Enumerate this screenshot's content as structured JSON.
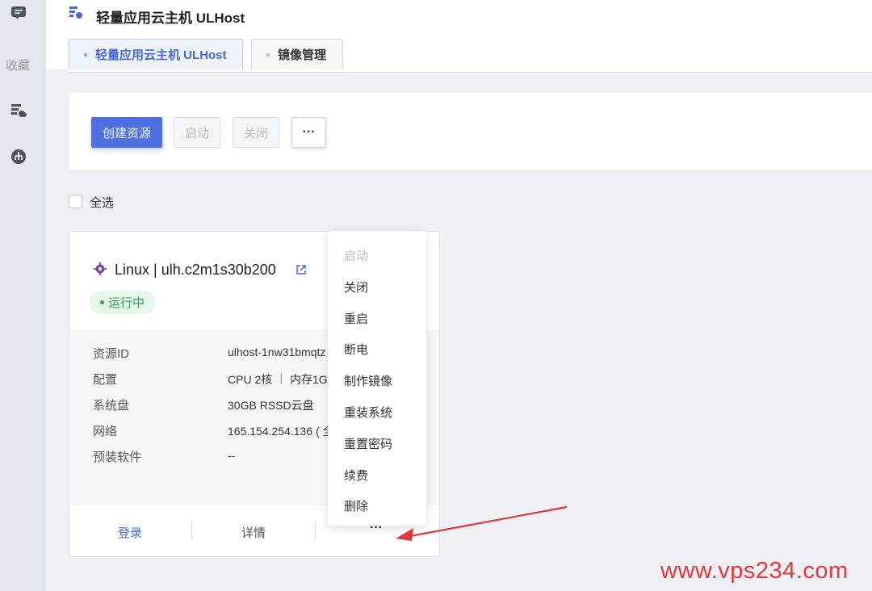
{
  "sidebar": {
    "favorites_label": "收藏"
  },
  "header": {
    "title": "轻量应用云主机 ULHost",
    "tabs": [
      {
        "label": "轻量应用云主机 ULHost"
      },
      {
        "label": "镜像管理"
      }
    ]
  },
  "toolbar": {
    "create_label": "创建资源",
    "start_label": "启动",
    "close_label": "关闭",
    "more_label": "···"
  },
  "select_all_label": "全选",
  "card": {
    "title": "Linux | ulh.c2m1s30b200",
    "status": "运行中",
    "info": [
      {
        "label": "资源ID",
        "value": "ulhost-1nw31bmqtz"
      },
      {
        "label": "配置",
        "value": "CPU 2核 ｜ 内存1G"
      },
      {
        "label": "系统盘",
        "value": "30GB RSSD云盘"
      },
      {
        "label": "网络",
        "value": "165.154.254.136 ( 全"
      },
      {
        "label": "预装软件",
        "value": "--"
      }
    ],
    "footer": {
      "login_label": "登录",
      "detail_label": "详情",
      "more_label": "···"
    }
  },
  "dropdown": {
    "items": [
      {
        "label": "启动"
      },
      {
        "label": "关闭"
      },
      {
        "label": "重启"
      },
      {
        "label": "断电"
      },
      {
        "label": "制作镜像"
      },
      {
        "label": "重装系统"
      },
      {
        "label": "重置密码"
      },
      {
        "label": "续费"
      },
      {
        "label": "删除"
      }
    ]
  },
  "watermark": "www.vps234.com",
  "colors": {
    "primary": "#4d6fe0",
    "running": "#2fa552",
    "watermark": "#e03a3a"
  }
}
